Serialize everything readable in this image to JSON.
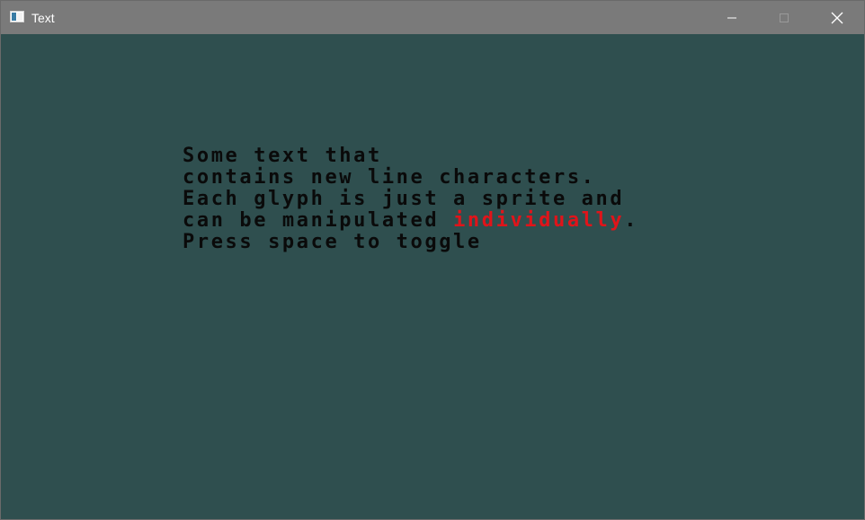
{
  "window": {
    "title": "Text",
    "icon": "app-window-icon",
    "controls": {
      "minimize_icon": "minimize-icon",
      "maximize_icon": "maximize-icon",
      "close_icon": "close-icon"
    }
  },
  "colors": {
    "titlebar": "#7a7a7a",
    "background": "#2f4f4f",
    "text": "#0a0a0a",
    "highlight": "#e0141a"
  },
  "content": {
    "line1": "Some text that",
    "line2": "contains new line characters.",
    "line3": "Each glyph is just a sprite and",
    "line4_before": "can be manipulated ",
    "line4_highlight": "individually",
    "line4_after": ".",
    "line5": "Press space to toggle"
  }
}
